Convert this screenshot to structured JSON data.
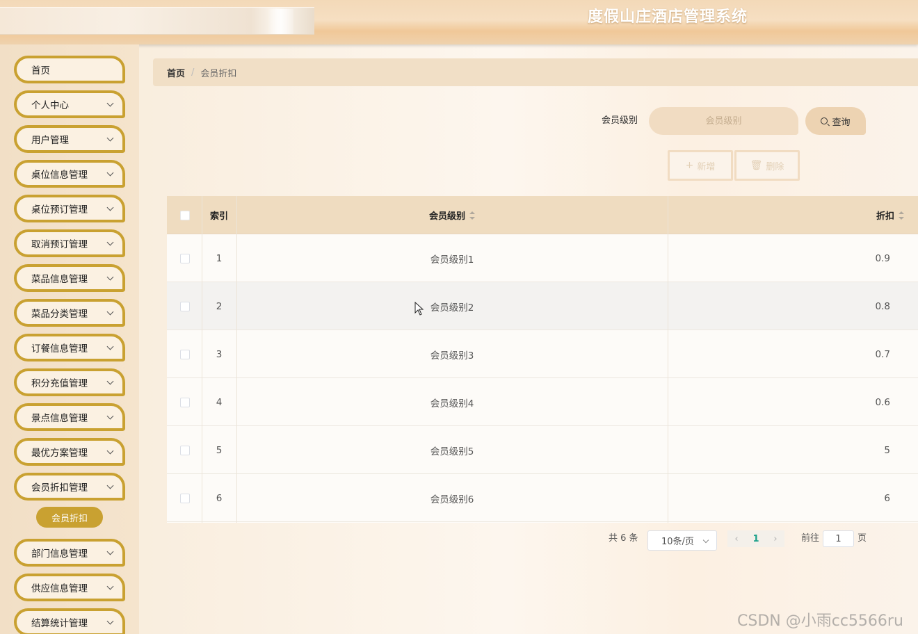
{
  "header": {
    "title": "度假山庄酒店管理系统"
  },
  "sidebar": {
    "items": [
      {
        "label": "首页",
        "has_children": false
      },
      {
        "label": "个人中心",
        "has_children": true
      },
      {
        "label": "用户管理",
        "has_children": true
      },
      {
        "label": "桌位信息管理",
        "has_children": true
      },
      {
        "label": "桌位预订管理",
        "has_children": true
      },
      {
        "label": "取消预订管理",
        "has_children": true
      },
      {
        "label": "菜品信息管理",
        "has_children": true
      },
      {
        "label": "菜品分类管理",
        "has_children": true
      },
      {
        "label": "订餐信息管理",
        "has_children": true
      },
      {
        "label": "积分充值管理",
        "has_children": true
      },
      {
        "label": "景点信息管理",
        "has_children": true
      },
      {
        "label": "最优方案管理",
        "has_children": true
      },
      {
        "label": "会员折扣管理",
        "has_children": true
      },
      {
        "label": "部门信息管理",
        "has_children": true
      },
      {
        "label": "供应信息管理",
        "has_children": true
      },
      {
        "label": "结算统计管理",
        "has_children": true
      }
    ],
    "active_submenu": "会员折扣"
  },
  "breadcrumb": {
    "home": "首页",
    "separator": "/",
    "current": "会员折扣"
  },
  "search": {
    "label": "会员级别",
    "placeholder": "会员级别",
    "button_label": "查询"
  },
  "actions": {
    "add_label": "新增",
    "delete_label": "删除"
  },
  "table": {
    "columns": {
      "index": "索引",
      "level": "会员级别",
      "discount": "折扣"
    },
    "rows": [
      {
        "index": "1",
        "level": "会员级别1",
        "discount": "0.9"
      },
      {
        "index": "2",
        "level": "会员级别2",
        "discount": "0.8"
      },
      {
        "index": "3",
        "level": "会员级别3",
        "discount": "0.7"
      },
      {
        "index": "4",
        "level": "会员级别4",
        "discount": "0.6"
      },
      {
        "index": "5",
        "level": "会员级别5",
        "discount": "5"
      },
      {
        "index": "6",
        "level": "会员级别6",
        "discount": "6"
      }
    ]
  },
  "pagination": {
    "total": "共 6 条",
    "page_size": "10条/页",
    "current_page": "1",
    "goto_label": "前往",
    "goto_value": "1",
    "page_suffix": "页",
    "prev_icon": "‹",
    "next_icon": "›"
  },
  "watermark": "CSDN @小雨cc5566ru",
  "colors": {
    "accent": "#c9a131",
    "header_bg": "#efdcc0",
    "pager_active": "#1aa08a"
  }
}
